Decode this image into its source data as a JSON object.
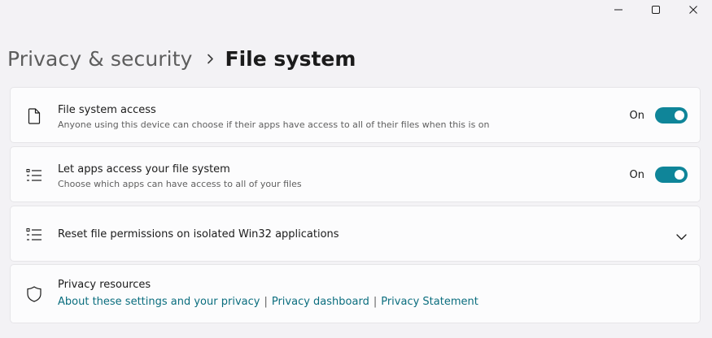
{
  "window": {
    "controls": [
      "minimize-icon",
      "maximize-icon",
      "close-icon"
    ]
  },
  "breadcrumb": {
    "parent": "Privacy & security",
    "separator_icon": "chevron-right-icon",
    "current": "File system"
  },
  "settings": {
    "file_system_access": {
      "icon": "document-icon",
      "title": "File system access",
      "description": "Anyone using this device can choose if their apps have access to all of their files when this is on",
      "state_label": "On",
      "enabled": true
    },
    "let_apps_access": {
      "icon": "list-icon",
      "title": "Let apps access your file system",
      "description": "Choose which apps can have access to all of your files",
      "state_label": "On",
      "enabled": true
    },
    "reset_permissions": {
      "icon": "list-icon",
      "title": "Reset file permissions on isolated Win32 applications",
      "expand_icon": "chevron-down-icon"
    },
    "privacy_resources": {
      "icon": "shield-icon",
      "title": "Privacy resources",
      "links": [
        "About these settings and your privacy",
        "Privacy dashboard",
        "Privacy Statement"
      ],
      "separator": "|"
    }
  },
  "colors": {
    "accent": "#0f8599",
    "link": "#0a6d7e",
    "background": "#f3f2f5",
    "card": "#fcfcfd"
  }
}
